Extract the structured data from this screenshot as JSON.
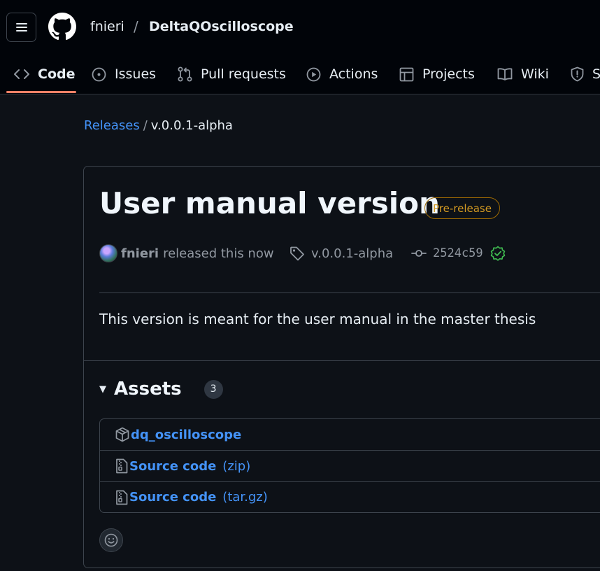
{
  "header": {
    "owner": "fnieri",
    "separator": "/",
    "repo": "DeltaQOscilloscope"
  },
  "tabs": [
    {
      "label": "Code",
      "icon": "code-icon"
    },
    {
      "label": "Issues",
      "icon": "issue-icon"
    },
    {
      "label": "Pull requests",
      "icon": "pull-request-icon"
    },
    {
      "label": "Actions",
      "icon": "play-icon"
    },
    {
      "label": "Projects",
      "icon": "table-icon"
    },
    {
      "label": "Wiki",
      "icon": "book-icon"
    },
    {
      "label": "S",
      "icon": "shield-icon"
    }
  ],
  "breadcrumb": {
    "parent": "Releases",
    "separator": "/",
    "current": "v.0.0.1-alpha"
  },
  "release": {
    "title": "User manual version",
    "badge": "Pre-release",
    "author": "fnieri",
    "released_text": "released this now",
    "tag": "v.0.0.1-alpha",
    "commit": "2524c59",
    "body": "This version is meant for the user manual in the master thesis"
  },
  "assets": {
    "title": "Assets",
    "count": "3",
    "items": [
      {
        "name": "dq_oscilloscope",
        "ext": "",
        "icon": "package-icon"
      },
      {
        "name": "Source code",
        "ext": "(zip)",
        "icon": "file-zip-icon"
      },
      {
        "name": "Source code",
        "ext": "(tar.gz)",
        "icon": "file-zip-icon"
      }
    ]
  },
  "colors": {
    "background": "#0d1117",
    "header": "#010409",
    "link": "#4493f8",
    "accent_underline": "#f78166",
    "prerelease": "#d29922",
    "verified": "#3fb950"
  }
}
